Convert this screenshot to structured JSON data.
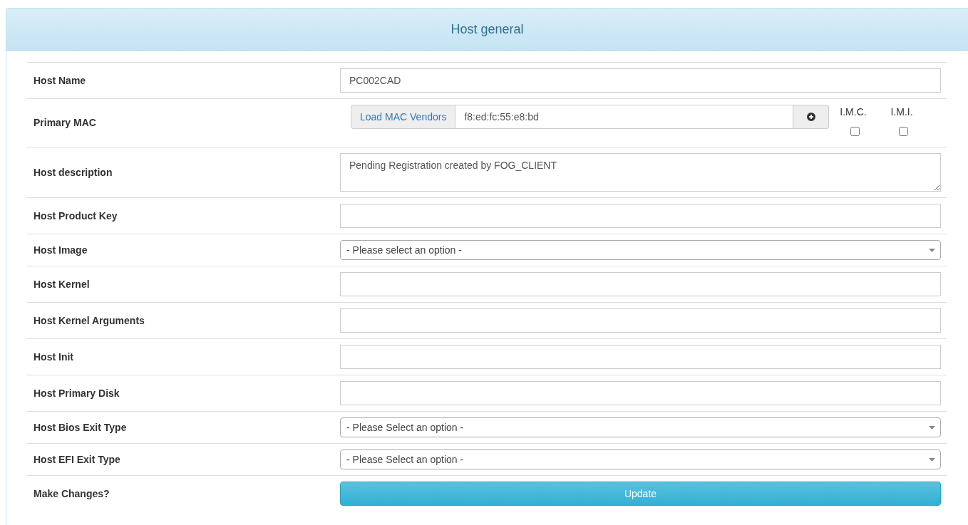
{
  "panel": {
    "title": "Host general"
  },
  "rows": [
    {
      "kind": "text",
      "label": "Host Name",
      "value": "PC002CAD"
    },
    {
      "kind": "mac",
      "label": "Primary MAC",
      "addon": "Load MAC Vendors",
      "value": "f8:ed:fc:55:e8:bd",
      "flags": [
        {
          "label": "I.M.C.",
          "checked": false
        },
        {
          "label": "I.M.I.",
          "checked": false
        }
      ]
    },
    {
      "kind": "textarea",
      "label": "Host description",
      "value": "Pending Registration created by FOG_CLIENT"
    },
    {
      "kind": "text",
      "label": "Host Product Key"
    },
    {
      "kind": "select",
      "label": "Host Image",
      "value": "- Please select an option -"
    },
    {
      "kind": "text",
      "label": "Host Kernel"
    },
    {
      "kind": "text",
      "label": "Host Kernel Arguments"
    },
    {
      "kind": "text",
      "label": "Host Init"
    },
    {
      "kind": "text",
      "label": "Host Primary Disk"
    },
    {
      "kind": "select",
      "label": "Host Bios Exit Type",
      "value": "- Please Select an option -"
    },
    {
      "kind": "select",
      "label": "Host EFI Exit Type",
      "value": "- Please Select an option -"
    },
    {
      "kind": "button",
      "label": "Make Changes?",
      "button": "Update"
    }
  ]
}
